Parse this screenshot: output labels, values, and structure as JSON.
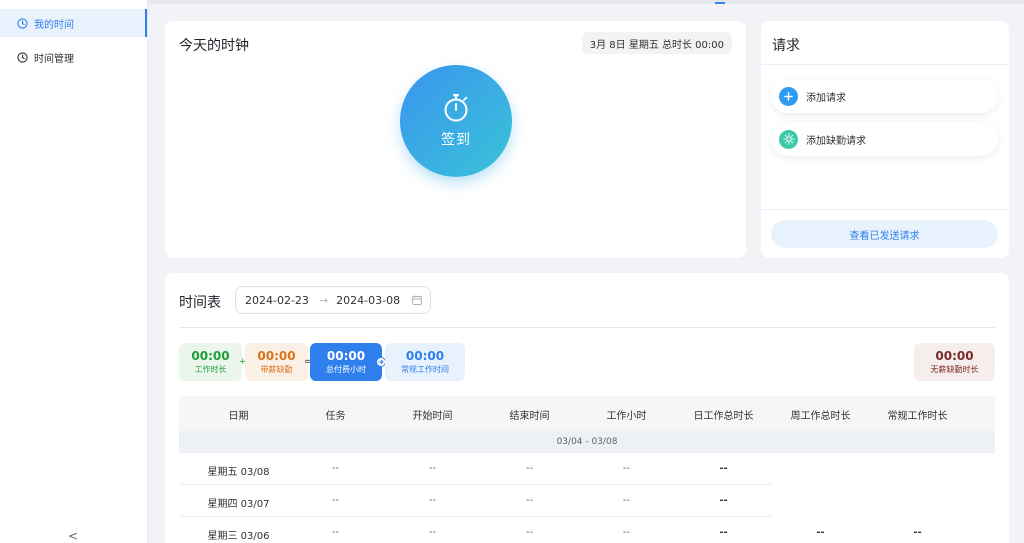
{
  "sidebar": {
    "items": [
      {
        "label": "我的时间",
        "active": true
      },
      {
        "label": "时间管理",
        "active": false
      }
    ],
    "collapse_glyph": "<"
  },
  "clock": {
    "title": "今天的时钟",
    "date_chip": "3月 8日 星期五 总时长 00:00",
    "checkin_label": "签到"
  },
  "requests": {
    "title": "请求",
    "add_request": "添加请求",
    "add_absence": "添加缺勤请求",
    "view_sent": "查看已发送请求"
  },
  "timesheet": {
    "title": "时间表",
    "range_start": "2024-02-23",
    "range_end": "2024-03-08",
    "range_arrow": "→",
    "summary": {
      "work": {
        "value": "00:00",
        "label": "工作时长"
      },
      "paid_absence": {
        "value": "00:00",
        "label": "带薪缺勤"
      },
      "total_paid": {
        "value": "00:00",
        "label": "总付费小时"
      },
      "regular": {
        "value": "00:00",
        "label": "常规工作时间"
      },
      "unpaid_absence": {
        "value": "00:00",
        "label": "无薪缺勤时长"
      },
      "plus": "+",
      "equals": "="
    },
    "columns": [
      "日期",
      "任务",
      "开始时间",
      "结束时间",
      "工作小时",
      "日工作总时长",
      "周工作总时长",
      "常规工作时长"
    ],
    "group_label": "03/04 - 03/08",
    "rows": [
      {
        "date": "星期五 03/08",
        "task": "--",
        "start": "--",
        "end": "--",
        "hours": "--",
        "day_total": "--"
      },
      {
        "date": "星期四 03/07",
        "task": "--",
        "start": "--",
        "end": "--",
        "hours": "--",
        "day_total": "--"
      },
      {
        "date": "星期三 03/06",
        "task": "--",
        "start": "--",
        "end": "--",
        "hours": "--",
        "day_total": "--",
        "week_total": "--",
        "regular": "--"
      }
    ]
  },
  "colors": {
    "accent": "#2f80ed",
    "work_green": "#1f9d3a",
    "paid_absence_orange": "#d9731a",
    "total_blue": "#2f80ed",
    "unpaid_red": "#7a2a2a"
  },
  "icons": {
    "my_time": "clock-icon",
    "time_mgmt": "clock-icon",
    "checkin": "stopwatch-icon",
    "add_request": "plus-icon",
    "add_absence": "sun-icon",
    "range": "calendar-icon"
  }
}
